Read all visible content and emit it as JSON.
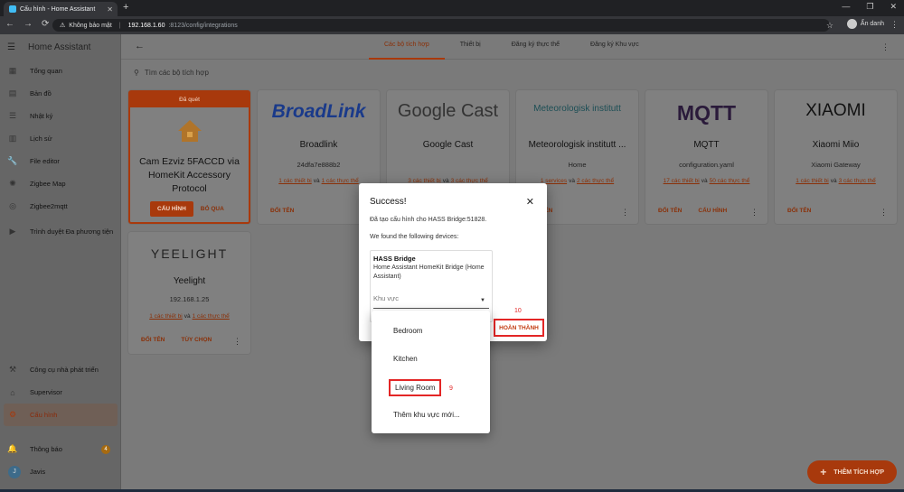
{
  "browser": {
    "tab_title": "Cấu hình - Home Assistant",
    "tab_close": "✕",
    "new_tab": "+",
    "security_label": "Không bảo mật",
    "url_host": "192.168.1.60",
    "url_path": ":8123/config/integrations",
    "profile_label": "Ẩn danh"
  },
  "sidebar": {
    "title": "Home Assistant",
    "items": [
      {
        "label": "Tổng quan",
        "icon": "dashboard-icon"
      },
      {
        "label": "Bản đồ",
        "icon": "map-icon"
      },
      {
        "label": "Nhật ký",
        "icon": "logbook-icon"
      },
      {
        "label": "Lịch sử",
        "icon": "history-icon"
      },
      {
        "label": "File editor",
        "icon": "wrench-icon"
      },
      {
        "label": "Zigbee Map",
        "icon": "zigbee-map-icon"
      },
      {
        "label": "Zigbee2mqtt",
        "icon": "zigbee-icon"
      },
      {
        "label": "Trình duyệt Đa phương tiện",
        "icon": "media-icon"
      }
    ],
    "bottom_items": [
      {
        "label": "Công cụ nhà phát triển",
        "icon": "hammer-icon"
      },
      {
        "label": "Supervisor",
        "icon": "supervisor-icon"
      },
      {
        "label": "Cấu hình",
        "icon": "gear-icon"
      }
    ],
    "notifications_label": "Thông báo",
    "notifications_count": "4",
    "user_initial": "J",
    "user_name": "Javis"
  },
  "header": {
    "tabs": [
      "Các bộ tích hợp",
      "Thiết bị",
      "Đăng ký thực thể",
      "Đăng ký Khu vực"
    ],
    "active_tab": 0
  },
  "search": {
    "placeholder": "Tìm các bộ tích hợp"
  },
  "discovered": {
    "banner": "Đã quét",
    "name": "Cam Ezviz 5FACCD via HomeKit Accessory Protocol",
    "configure_label": "CẤU HÌNH",
    "skip_label": "BỎ QUA"
  },
  "integrations": [
    {
      "logo": "BroadLink",
      "name": "Broadlink",
      "sub": "24dfa7e888b2",
      "link_a": "1 các thiết bị",
      "link_b": "1 các thực thể",
      "action1": "ĐỔI TÊN",
      "action2": ""
    },
    {
      "logo": "Google Cast",
      "name": "Google Cast",
      "sub": "",
      "link_a": "3 các thiết bị",
      "link_b": "3 các thực thể",
      "action1": "",
      "action2": ""
    },
    {
      "logo": "Meteorologisk institutt",
      "name": "Meteorologisk institutt ...",
      "sub": "Home",
      "link_a": "1 services",
      "link_b": "2 các thực thể",
      "action1": "ĐỔI TÊN",
      "action2": ""
    },
    {
      "logo": "MQTT",
      "name": "MQTT",
      "sub": "configuration.yaml",
      "link_a": "17 các thiết bị",
      "link_b": "50 các thực thể",
      "action1": "ĐỔI TÊN",
      "action2": "CẤU HÌNH"
    },
    {
      "logo": "XIAOMI",
      "name": "Xiaomi Miio",
      "sub": "Xiaomi Gateway",
      "link_a": "1 các thiết bị",
      "link_b": "3 các thực thể",
      "action1": "ĐỔI TÊN",
      "action2": ""
    },
    {
      "logo": "YEELIGHT",
      "name": "Yeelight",
      "sub": "192.168.1.25",
      "link_a": "1 các thiết bị",
      "link_b": "1 các thực thể",
      "action1": "ĐỔI TÊN",
      "action2": "TÙY CHỌN"
    }
  ],
  "links_joiner": "và",
  "fab_label": "THÊM TÍCH HỢP",
  "dialog": {
    "title": "Success!",
    "message": "Đã tạo cấu hình cho HASS Bridge:51828.",
    "found_text": "We found the following devices:",
    "device_name": "HASS Bridge",
    "device_desc": "Home Assistant HomeKit Bridge (Home Assistant)",
    "area_placeholder": "Khu vực",
    "done_label": "HOÀN THÀNH",
    "step_done": "10"
  },
  "area_dropdown": {
    "options": [
      "Bedroom",
      "Kitchen",
      "Living Room",
      "Thêm khu vực mới..."
    ],
    "highlighted": "Living Room",
    "step_select": "9"
  },
  "colors": {
    "accent": "#a8390c",
    "annotation": "#e32626"
  }
}
